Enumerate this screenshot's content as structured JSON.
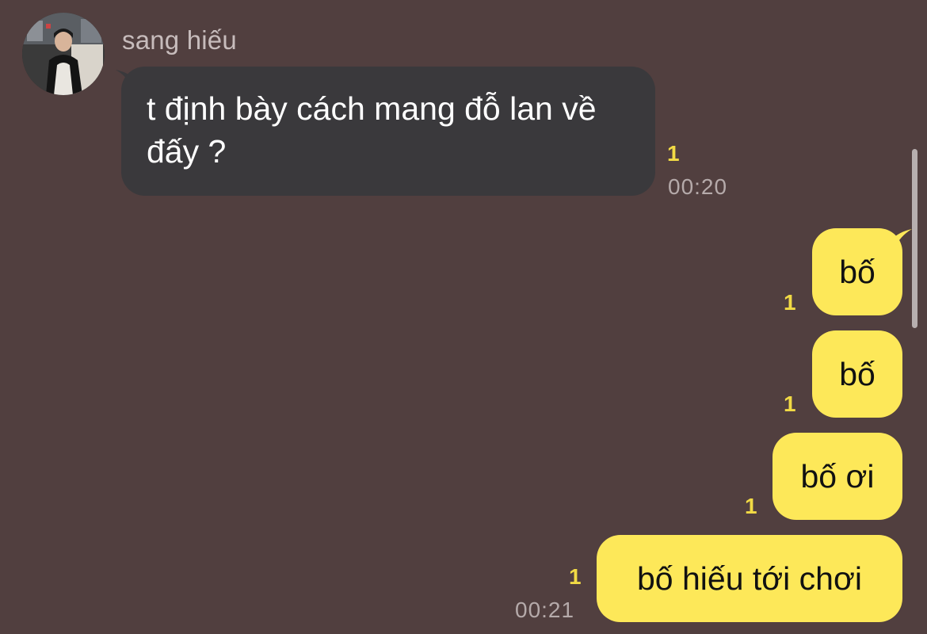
{
  "chat": {
    "background": "#513f3f",
    "incoming": {
      "sender_name": "sang hiếu",
      "text": "t định bày cách mang đỗ lan về đấy ?",
      "unread_count": "1",
      "time": "00:20",
      "bubble_color": "#3a393c"
    },
    "outgoing": [
      {
        "text": "bố",
        "unread_count": "1"
      },
      {
        "text": "bố",
        "unread_count": "1"
      },
      {
        "text": "bố ơi",
        "unread_count": "1"
      },
      {
        "text": "bố hiếu tới chơi",
        "unread_count": "1",
        "time": "00:21"
      }
    ],
    "outgoing_bubble_color": "#fde859",
    "unread_color": "#f1da45",
    "icons": {
      "avatar": "profile-photo-avatar"
    }
  }
}
